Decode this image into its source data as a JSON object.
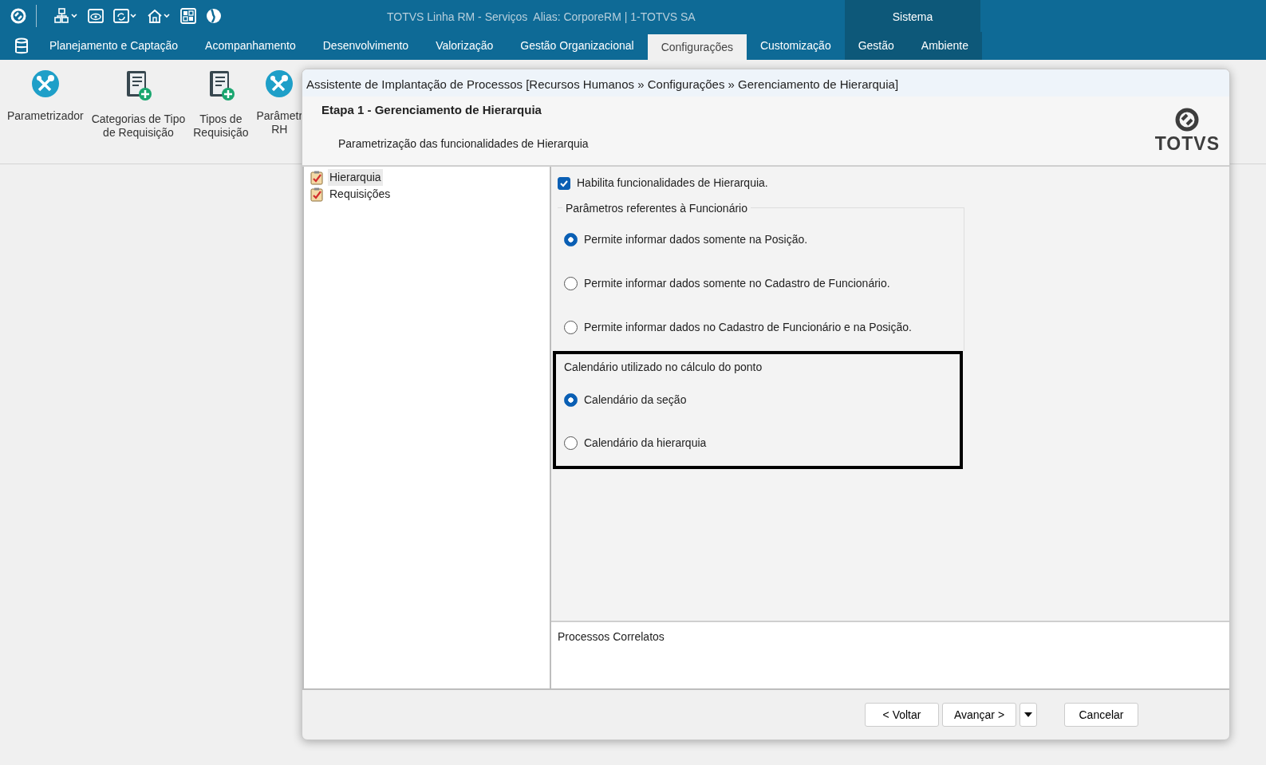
{
  "app": {
    "title": "TOTVS Linha RM - Serviços  Alias: CorporeRM | 1-TOTVS SA",
    "context_label": "Sistema"
  },
  "menu_tabs": [
    {
      "label": "Planejamento e Captação",
      "selected": false,
      "kind": "module"
    },
    {
      "label": "Acompanhamento",
      "selected": false,
      "kind": "module"
    },
    {
      "label": "Desenvolvimento",
      "selected": false,
      "kind": "module"
    },
    {
      "label": "Valorização",
      "selected": false,
      "kind": "module"
    },
    {
      "label": "Gestão Organizacional",
      "selected": false,
      "kind": "module"
    },
    {
      "label": "Configurações",
      "selected": true,
      "kind": "module"
    },
    {
      "label": "Customização",
      "selected": false,
      "kind": "module"
    },
    {
      "label": "Gestão",
      "selected": false,
      "kind": "system"
    },
    {
      "label": "Ambiente",
      "selected": false,
      "kind": "system"
    }
  ],
  "ribbon": [
    {
      "lines": [
        "Parametrizador"
      ],
      "kind": "tools"
    },
    {
      "lines": [
        "Categorias de Tipo",
        "de Requisição"
      ],
      "kind": "document"
    },
    {
      "lines": [
        "Tipos de",
        "Requisição"
      ],
      "kind": "document"
    },
    {
      "lines": [
        "Parâmetr",
        "RH"
      ],
      "kind": "tools"
    }
  ],
  "dialog": {
    "title": "Assistente de Implantação de Processos [Recursos Humanos » Configurações » Gerenciamento de Hierarquia]",
    "step_title": "Etapa 1 - Gerenciamento de Hierarquia",
    "step_subtitle": "Parametrização das funcionalidades de Hierarquia",
    "logo_text": "TOTVS",
    "tree": [
      {
        "label": "Hierarquia",
        "selected": true
      },
      {
        "label": "Requisições",
        "selected": false
      }
    ],
    "enable_checkbox": {
      "label": "Habilita funcionalidades de Hierarquia.",
      "checked": true
    },
    "groups": [
      {
        "legend": "Parâmetros referentes à Funcionário",
        "highlighted": false,
        "options": [
          {
            "label": "Permite informar dados somente na Posição.",
            "selected": true
          },
          {
            "label": "Permite informar dados somente no Cadastro de Funcionário.",
            "selected": false
          },
          {
            "label": "Permite informar dados no Cadastro de Funcionário e na Posição.",
            "selected": false
          }
        ]
      },
      {
        "legend": "Calendário utilizado no cálculo do ponto",
        "highlighted": true,
        "options": [
          {
            "label": "Calendário da seção",
            "selected": true
          },
          {
            "label": "Calendário da hierarquia",
            "selected": false
          }
        ]
      }
    ],
    "related_label": "Processos Correlatos",
    "buttons": [
      {
        "label": "< Voltar",
        "kind": "button"
      },
      {
        "label": "Avançar >",
        "kind": "button"
      },
      {
        "kind": "dropdown"
      },
      {
        "label": "Cancelar",
        "kind": "button"
      }
    ]
  }
}
